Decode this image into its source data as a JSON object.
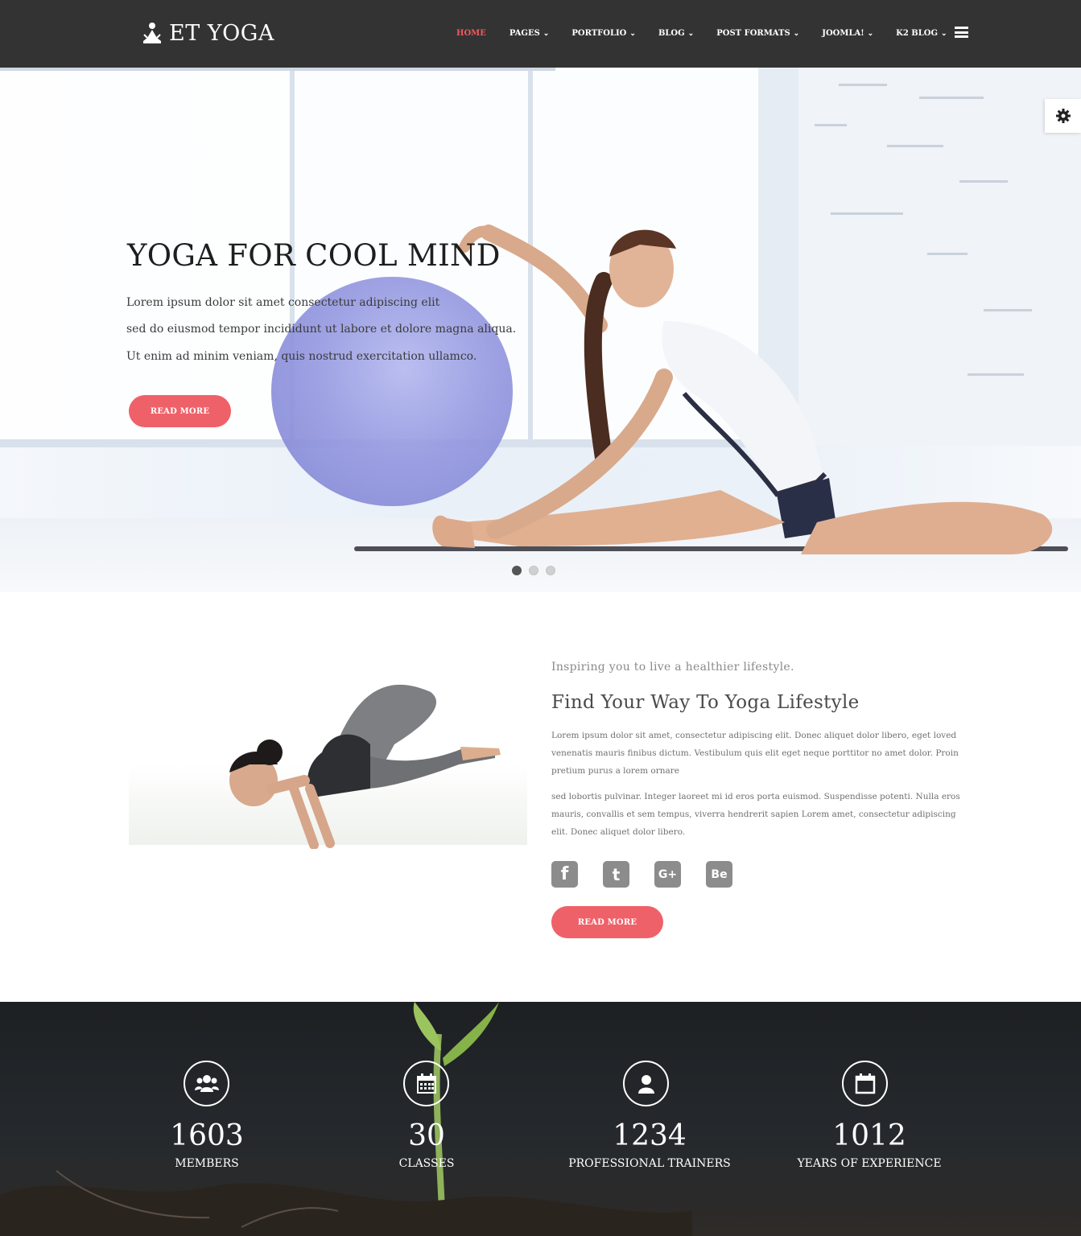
{
  "header": {
    "logo_text": "ET YOGA",
    "nav": [
      {
        "label": "HOME",
        "active": true,
        "dropdown": false
      },
      {
        "label": "PAGES",
        "active": false,
        "dropdown": true
      },
      {
        "label": "PORTFOLIO",
        "active": false,
        "dropdown": true
      },
      {
        "label": "BLOG",
        "active": false,
        "dropdown": true
      },
      {
        "label": "POST FORMATS",
        "active": false,
        "dropdown": true
      },
      {
        "label": "JOOMLA!",
        "active": false,
        "dropdown": true
      },
      {
        "label": "K2 BLOG",
        "active": false,
        "dropdown": true
      }
    ],
    "menu_icon": "hamburger-icon"
  },
  "hero": {
    "title": "YOGA FOR COOL MIND",
    "lines": [
      "Lorem ipsum dolor sit amet consectetur adipiscing elit",
      "sed do eiusmod tempor incididunt ut labore et dolore magna aliqua.",
      "Ut enim ad minim veniam, quis nostrud exercitation ullamco."
    ],
    "button_label": "READ MORE",
    "slide_count": 3,
    "active_slide": 1,
    "settings_icon": "gear-icon"
  },
  "about": {
    "subtitle": "Inspiring you to live a healthier lifestyle.",
    "title": "Find Your Way To Yoga Lifestyle",
    "paragraphs": [
      "Lorem ipsum dolor sit amet, consectetur adipiscing elit. Donec aliquet dolor libero, eget loved venenatis mauris finibus dictum. Vestibulum quis elit eget neque porttitor no amet dolor. Proin pretium purus a lorem ornare",
      "sed lobortis pulvinar. Integer laoreet mi id eros porta euismod. Suspendisse potenti. Nulla eros mauris, convallis et sem tempus, viverra hendrerit sapien Lorem amet, consectetur adipiscing elit. Donec aliquet dolor libero."
    ],
    "socials": [
      {
        "icon": "facebook-icon",
        "glyph": "f"
      },
      {
        "icon": "twitter-icon",
        "glyph": "t"
      },
      {
        "icon": "google-plus-icon",
        "glyph": "G+"
      },
      {
        "icon": "behance-icon",
        "glyph": "Be"
      }
    ],
    "button_label": "READ MORE"
  },
  "stats": [
    {
      "icon": "users-icon",
      "number": "1603",
      "label": "MEMBERS"
    },
    {
      "icon": "calendar-grid-icon",
      "number": "30",
      "label": "CLASSES"
    },
    {
      "icon": "user-icon",
      "number": "1234",
      "label": "PROFESSIONAL TRAINERS"
    },
    {
      "icon": "calendar-icon",
      "number": "1012",
      "label": "YEARS OF EXPERIENCE"
    }
  ],
  "colors": {
    "header_bg": "#333333",
    "accent": "#ef6169",
    "stats_bg": "#1d2023"
  }
}
